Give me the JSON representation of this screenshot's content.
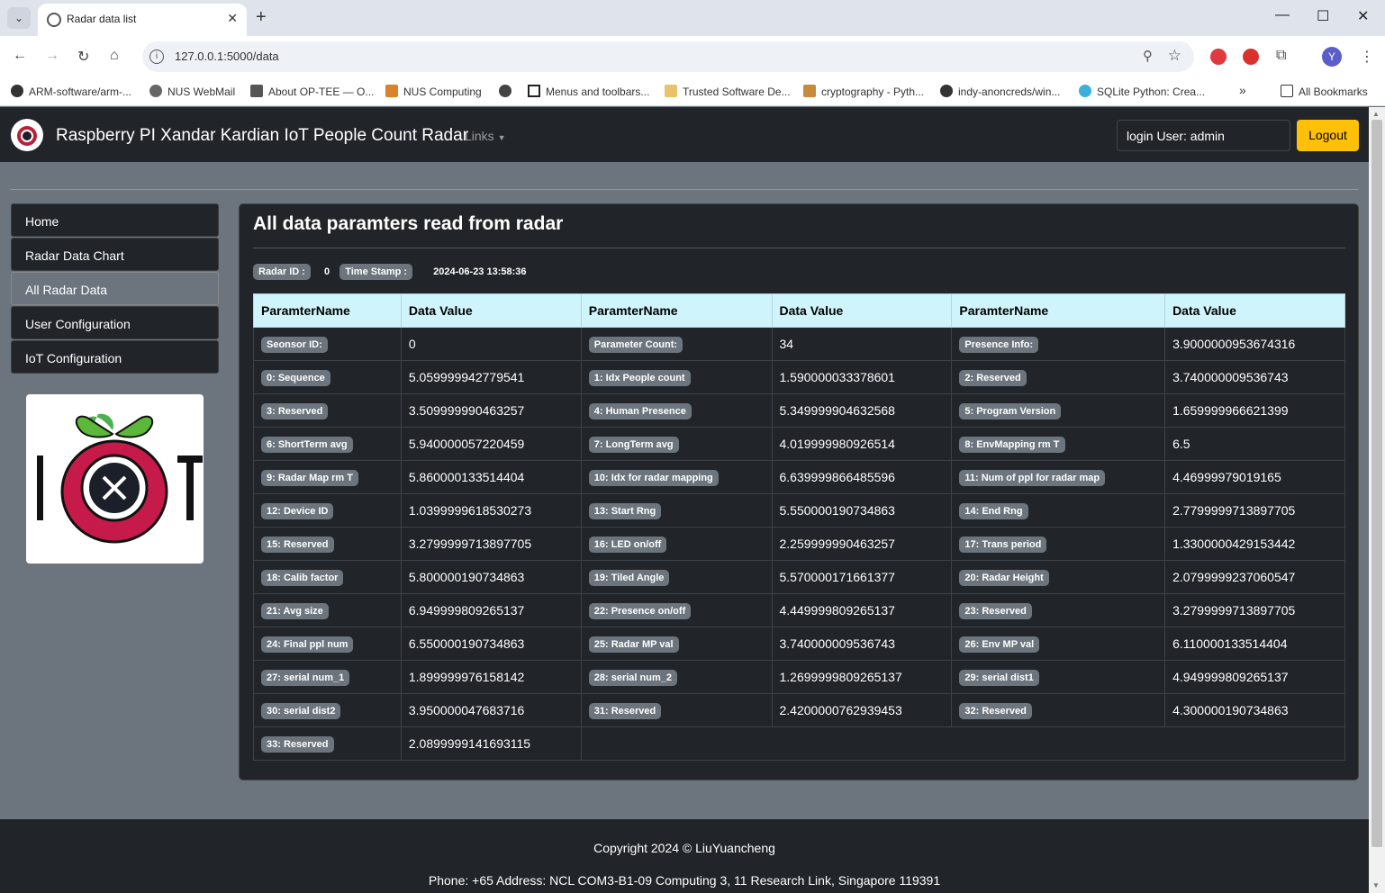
{
  "browser": {
    "tab_title": "Radar data list",
    "url": "127.0.0.1:5000/data",
    "bookmarks": [
      "ARM-software/arm-...",
      "NUS WebMail",
      "About OP-TEE — O...",
      "NUS Computing",
      "",
      "Menus and toolbars...",
      "Trusted Software De...",
      "cryptography - Pyth...",
      "indy-anoncreds/win...",
      "SQLite Python: Crea..."
    ],
    "all_bookmarks": "All Bookmarks",
    "profile_initial": "Y"
  },
  "navbar": {
    "brand": "Raspberry PI Xandar Kardian IoT People Count Radar",
    "links": "Links",
    "login_user": "login User: admin",
    "logout": "Logout"
  },
  "sidenav": {
    "items": [
      "Home",
      "Radar Data Chart",
      "All Radar Data",
      "User Configuration",
      "IoT Configuration"
    ],
    "active_index": 2
  },
  "main": {
    "title": "All data paramters read from radar",
    "radar_id_label": "Radar ID :",
    "radar_id": "0",
    "timestamp_label": "Time Stamp :",
    "timestamp": "2024-06-23 13:58:36",
    "headers": [
      "ParamterName",
      "Data Value",
      "ParamterName",
      "Data Value",
      "ParamterName",
      "Data Value"
    ],
    "rows": [
      [
        "Seonsor ID:",
        "0",
        "Parameter Count:",
        "34",
        "Presence Info:",
        "3.9000000953674316"
      ],
      [
        "0: Sequence",
        "5.059999942779541",
        "1: Idx People count",
        "1.590000033378601",
        "2: Reserved",
        "3.740000009536743"
      ],
      [
        "3: Reserved",
        "3.509999990463257",
        "4: Human Presence",
        "5.349999904632568",
        "5: Program Version",
        "1.659999966621399"
      ],
      [
        "6: ShortTerm avg",
        "5.940000057220459",
        "7: LongTerm avg",
        "4.019999980926514",
        "8: EnvMapping rm T",
        "6.5"
      ],
      [
        "9: Radar Map rm T",
        "5.860000133514404",
        "10: Idx for radar mapping",
        "6.639999866485596",
        "11: Num of ppl for radar map",
        "4.46999979019165"
      ],
      [
        "12: Device ID",
        "1.0399999618530273",
        "13: Start Rng",
        "5.550000190734863",
        "14: End Rng",
        "2.7799999713897705"
      ],
      [
        "15: Reserved",
        "3.2799999713897705",
        "16: LED on/off",
        "2.259999990463257",
        "17: Trans period",
        "1.3300000429153442"
      ],
      [
        "18: Calib factor",
        "5.800000190734863",
        "19: Tiled Angle",
        "5.570000171661377",
        "20: Radar Height",
        "2.0799999237060547"
      ],
      [
        "21: Avg size",
        "6.949999809265137",
        "22: Presence on/off",
        "4.449999809265137",
        "23: Reserved",
        "3.2799999713897705"
      ],
      [
        "24: Final ppl num",
        "6.550000190734863",
        "25: Radar MP val",
        "3.740000009536743",
        "26: Env MP val",
        "6.110000133514404"
      ],
      [
        "27: serial num_1",
        "1.899999976158142",
        "28: serial num_2",
        "1.2699999809265137",
        "29: serial dist1",
        "4.949999809265137"
      ],
      [
        "30: serial dist2",
        "3.950000047683716",
        "31: Reserved",
        "2.4200000762939453",
        "32: Reserved",
        "4.300000190734863"
      ],
      [
        "33: Reserved",
        "2.0899999141693115"
      ]
    ]
  },
  "footer": {
    "copyright": "Copyright 2024 © LiuYuancheng",
    "contact": "Phone: +65 Address: NCL COM3-B1-09 Computing 3, 11 Research Link, Singapore 119391"
  },
  "logo_text": "IOT"
}
